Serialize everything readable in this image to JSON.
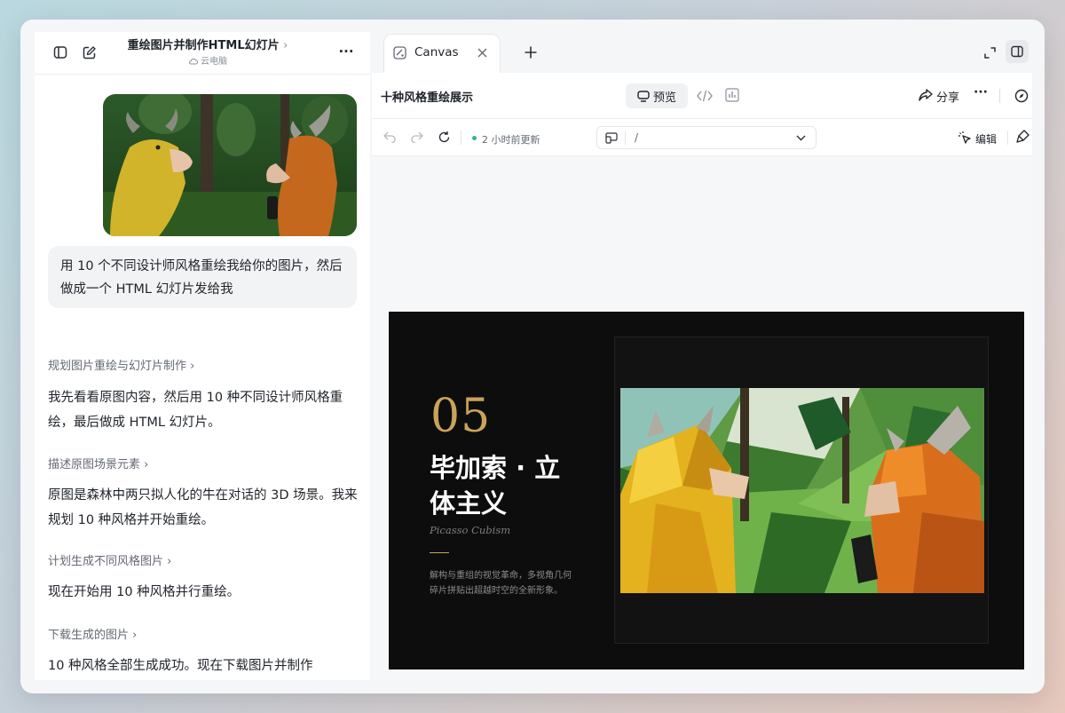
{
  "conversation": {
    "title": "重绘图片并制作HTML幻灯片",
    "title_chevron": "›",
    "subtitle": "云电脑",
    "more": "···",
    "user_message": "用 10 个不同设计师风格重绘我给你的图片，然后做成一个 HTML 幻灯片发给我",
    "steps": [
      {
        "label": "规划图片重绘与幻灯片制作 ›",
        "text": "我先看看原图内容，然后用 10 种不同设计师风格重绘，最后做成 HTML 幻灯片。"
      },
      {
        "label": "描述原图场景元素 ›",
        "text": "原图是森林中两只拟人化的牛在对话的 3D 场景。我来规划 10 种风格并开始重绘。"
      },
      {
        "label": "计划生成不同风格图片 ›",
        "text": "现在开始用 10 种风格并行重绘。"
      },
      {
        "label": "下载生成的图片 ›",
        "text": "10 种风格全部生成成功。现在下载图片并制作"
      }
    ]
  },
  "canvas": {
    "tab_label": "Canvas",
    "doc_title": "十种风格重绘展示",
    "preview_label": "预览",
    "share_label": "分享",
    "more": "···",
    "update_text": "2 小时前更新",
    "url_value": "/",
    "edit_label": "编辑"
  },
  "slide": {
    "number": "05",
    "title": "毕加索 · 立体主义",
    "subtitle_en": "Picasso Cubism",
    "description": "解构与重组的视觉革命，多视角几何碎片拼贴出超越时空的全新形象。"
  },
  "colors": {
    "accent_gold": "#c9a35a",
    "status_green": "#2eb87a",
    "slide_bg": "#0d0d0d"
  }
}
